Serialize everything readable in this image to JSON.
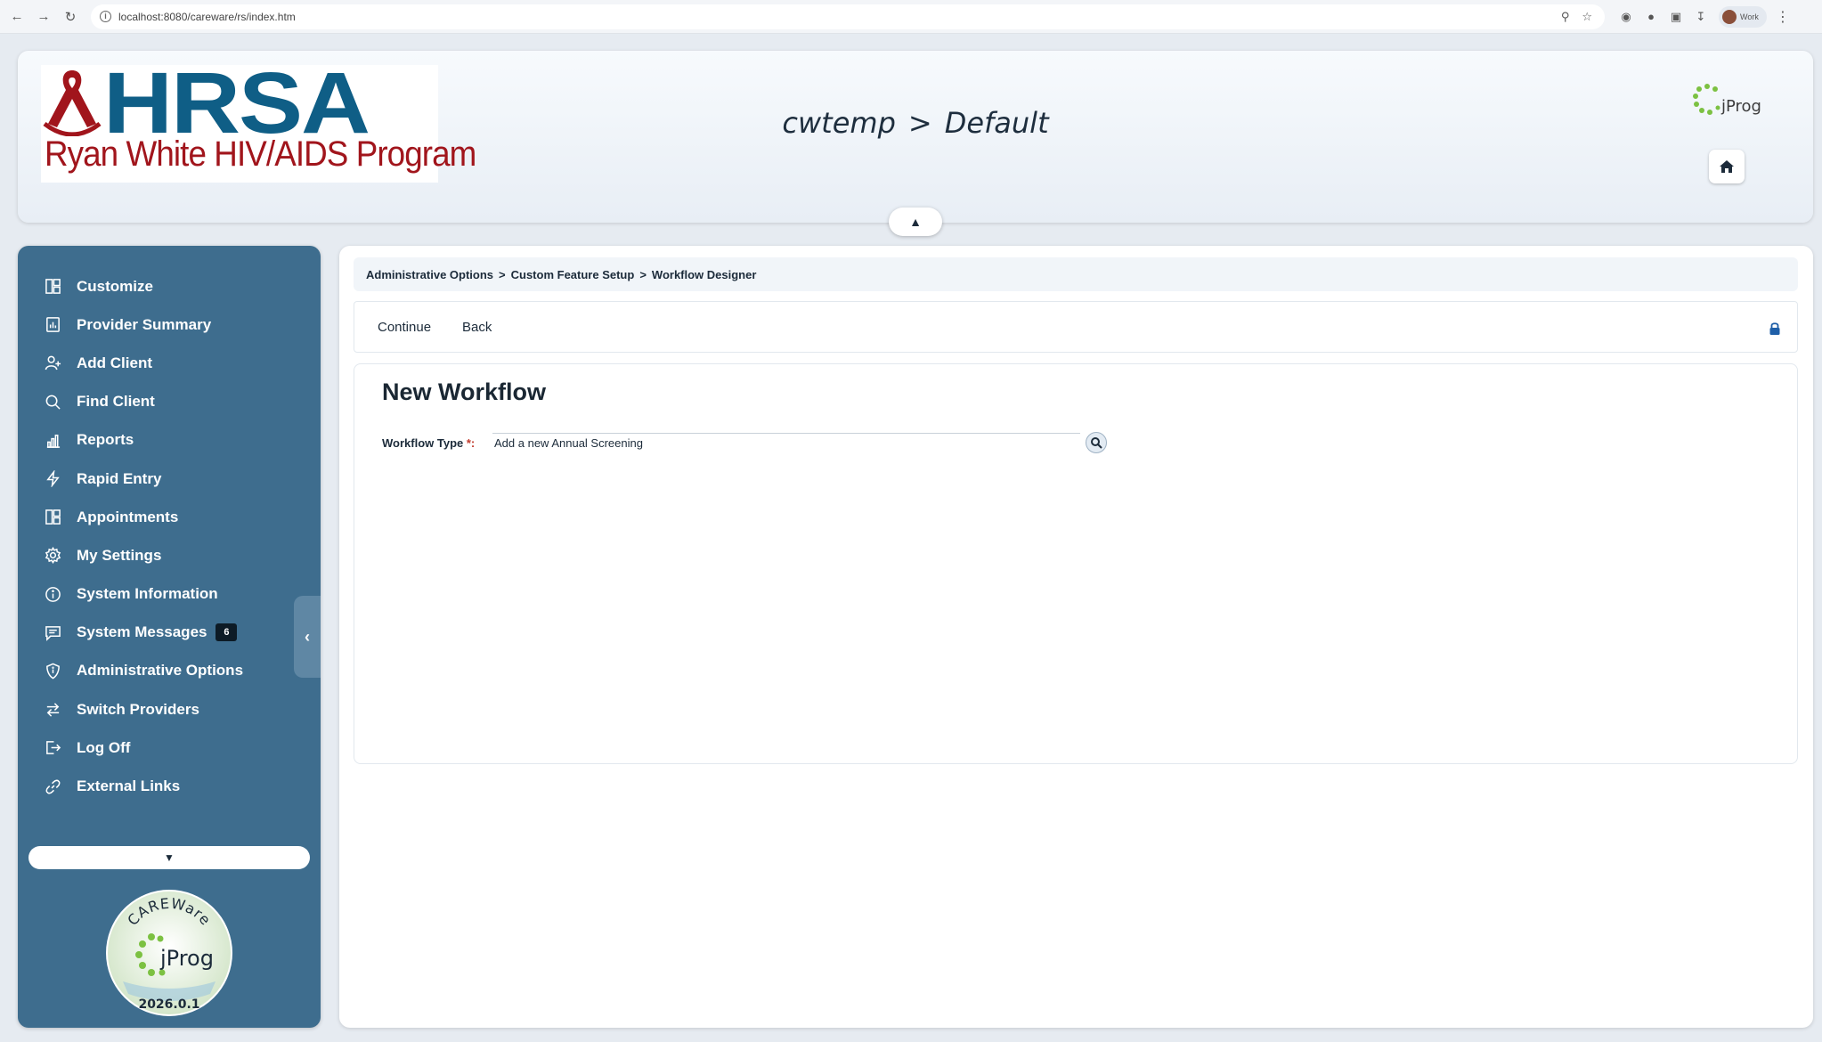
{
  "browser": {
    "url": "localhost:8080/careware/rs/index.htm",
    "profile_label": "Work"
  },
  "header": {
    "logo_wordmark": "HRSA",
    "logo_program": "Ryan White HIV/AIDS Program",
    "title_left": "cwtemp",
    "title_sep": ">",
    "title_right": "Default",
    "jprog_label": "jProg"
  },
  "sidebar": {
    "items": [
      {
        "label": "Customize",
        "icon": "layout-icon"
      },
      {
        "label": "Provider Summary",
        "icon": "report-icon"
      },
      {
        "label": "Add Client",
        "icon": "add-user-icon"
      },
      {
        "label": "Find Client",
        "icon": "search-icon"
      },
      {
        "label": "Reports",
        "icon": "bar-chart-icon"
      },
      {
        "label": "Rapid Entry",
        "icon": "lightning-icon"
      },
      {
        "label": "Appointments",
        "icon": "layout-icon"
      },
      {
        "label": "My Settings",
        "icon": "gear-icon"
      },
      {
        "label": "System Information",
        "icon": "info-icon"
      },
      {
        "label": "System Messages",
        "icon": "message-icon",
        "badge": "6"
      },
      {
        "label": "Administrative Options",
        "icon": "shield-icon"
      },
      {
        "label": "Switch Providers",
        "icon": "switch-icon"
      },
      {
        "label": "Log Off",
        "icon": "logout-icon"
      },
      {
        "label": "External Links",
        "icon": "link-icon"
      }
    ],
    "badge_logo": {
      "top_text": "CAREWare",
      "center_text": "jProg",
      "version": "2026.0.1"
    }
  },
  "breadcrumb": {
    "items": [
      "Administrative Options",
      "Custom Feature Setup",
      "Workflow Designer"
    ],
    "separator": ">"
  },
  "toolbar": {
    "continue_label": "Continue",
    "back_label": "Back"
  },
  "form": {
    "title": "New Workflow",
    "workflow_type_label": "Workflow Type",
    "required_marker": "*:",
    "workflow_type_value": "Add a new Annual Screening"
  },
  "colors": {
    "sidebar_bg": "#3e6d8e",
    "hrsa_blue": "#0f5e86",
    "hrsa_red": "#a1151c",
    "lock_blue": "#1f5fa8"
  }
}
